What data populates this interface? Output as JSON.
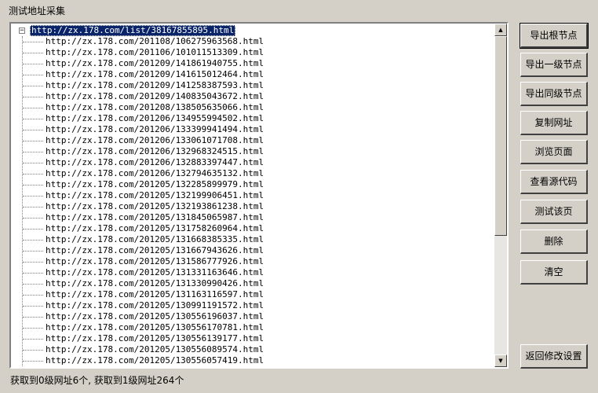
{
  "window": {
    "title": "测试地址采集"
  },
  "tree": {
    "root": "http://zx.178.com/list/38167855895.html",
    "expander": "−",
    "children": [
      "http://zx.178.com/201108/106275963568.html",
      "http://zx.178.com/201106/101011513309.html",
      "http://zx.178.com/201209/141861940755.html",
      "http://zx.178.com/201209/141615012464.html",
      "http://zx.178.com/201209/141258387593.html",
      "http://zx.178.com/201209/140835043672.html",
      "http://zx.178.com/201208/138505635066.html",
      "http://zx.178.com/201206/134955994502.html",
      "http://zx.178.com/201206/133399941494.html",
      "http://zx.178.com/201206/133061071708.html",
      "http://zx.178.com/201206/132968324515.html",
      "http://zx.178.com/201206/132883397447.html",
      "http://zx.178.com/201206/132794635132.html",
      "http://zx.178.com/201205/132285899979.html",
      "http://zx.178.com/201205/132199906451.html",
      "http://zx.178.com/201205/132193861238.html",
      "http://zx.178.com/201205/131845065987.html",
      "http://zx.178.com/201205/131758260964.html",
      "http://zx.178.com/201205/131668385335.html",
      "http://zx.178.com/201205/131667943626.html",
      "http://zx.178.com/201205/131586777926.html",
      "http://zx.178.com/201205/131331163646.html",
      "http://zx.178.com/201205/131330990426.html",
      "http://zx.178.com/201205/131163116597.html",
      "http://zx.178.com/201205/130991191572.html",
      "http://zx.178.com/201205/130556196037.html",
      "http://zx.178.com/201205/130556170781.html",
      "http://zx.178.com/201205/130556139177.html",
      "http://zx.178.com/201205/130556089574.html",
      "http://zx.178.com/201205/130556057419.html"
    ]
  },
  "buttons": {
    "export_root": "导出根节点",
    "export_level1": "导出一级节点",
    "export_sibling": "导出同级节点",
    "copy_url": "复制网址",
    "browse_page": "浏览页面",
    "view_source": "查看源代码",
    "test_page": "测试该页",
    "delete": "删除",
    "clear": "清空",
    "back_to_settings": "返回修改设置"
  },
  "scrollbar": {
    "up_icon": "▲",
    "down_icon": "▼"
  },
  "status": {
    "text": "获取到0级网址6个, 获取到1级网址264个"
  }
}
